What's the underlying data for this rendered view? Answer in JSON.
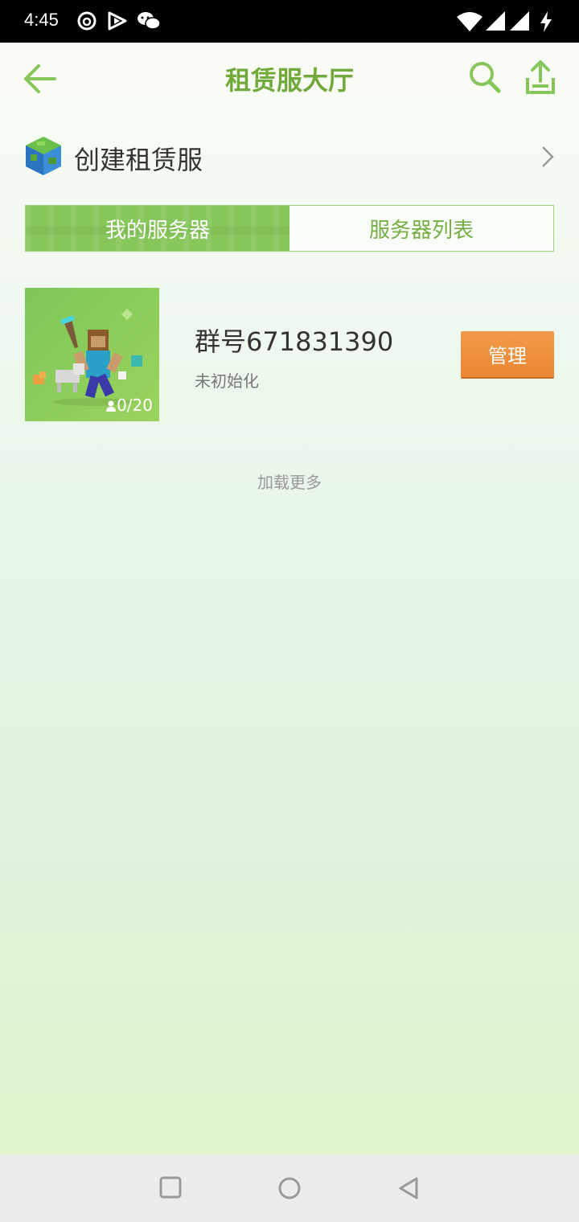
{
  "status_bar": {
    "time": "4:45",
    "icons": [
      "netease-music-icon",
      "video-app-icon",
      "wechat-icon",
      "wifi-icon",
      "signal-icon",
      "signal-icon-2",
      "charging-icon"
    ]
  },
  "header": {
    "title": "租赁服大厅",
    "back_icon": "arrow-left-icon",
    "search_icon": "search-icon",
    "share_icon": "upload-icon"
  },
  "create": {
    "label": "创建租赁服",
    "icon": "globe-block-icon"
  },
  "tabs": [
    {
      "label": "我的服务器",
      "active": true
    },
    {
      "label": "服务器列表",
      "active": false
    }
  ],
  "servers": [
    {
      "name": "群号671831390",
      "status": "未初始化",
      "players": "0/20",
      "manage_label": "管理"
    }
  ],
  "load_more": "加载更多",
  "colors": {
    "accent": "#71a93a",
    "tab_active": "#86c65a",
    "manage": "#ed8c38"
  },
  "nav": {
    "icons": [
      "recents-square-icon",
      "home-circle-icon",
      "back-triangle-icon"
    ]
  }
}
